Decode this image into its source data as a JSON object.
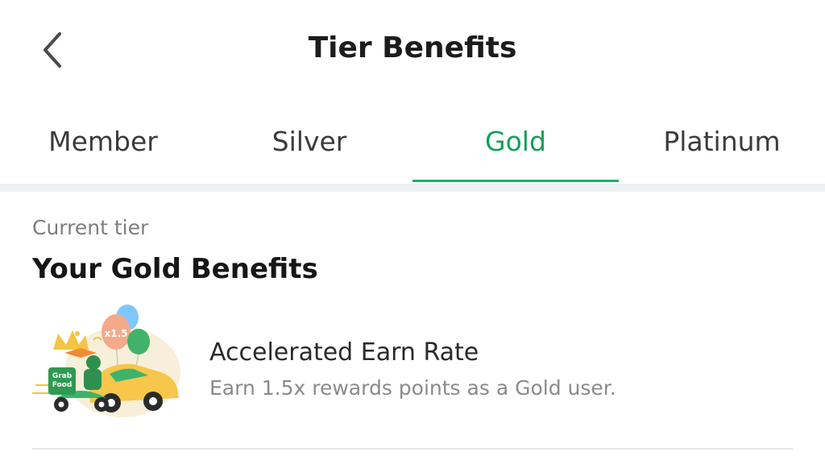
{
  "header": {
    "title": "Tier Benefits",
    "back_icon": "chevron-left-icon"
  },
  "tabs": [
    {
      "label": "Member",
      "active": false
    },
    {
      "label": "Silver",
      "active": false
    },
    {
      "label": "Gold",
      "active": true
    },
    {
      "label": "Platinum",
      "active": false
    }
  ],
  "colors": {
    "accent": "#11a05a",
    "text_primary": "#1c1c1c",
    "text_secondary": "#8a8a8a"
  },
  "section": {
    "eyebrow": "Current tier",
    "title": "Your Gold Benefits"
  },
  "benefits": [
    {
      "title": "Accelerated Earn Rate",
      "description": "Earn 1.5x rewards points as a Gold user.",
      "illustration": "grabfood-delivery-balloons-illustration",
      "badge_text": "x1.5",
      "box_text_line1": "Grab",
      "box_text_line2": "Food"
    }
  ]
}
